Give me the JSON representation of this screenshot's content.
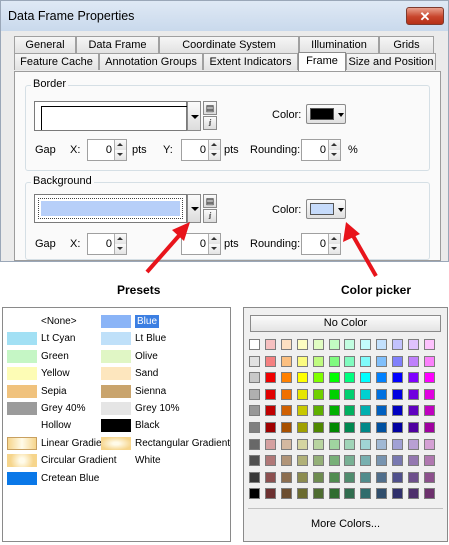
{
  "dialog": {
    "title": "Data Frame Properties",
    "close": "✕",
    "tabs_row1": [
      "General",
      "Data Frame",
      "Coordinate System",
      "Illumination",
      "Grids"
    ],
    "tabs_row2": [
      "Feature Cache",
      "Annotation Groups",
      "Extent Indicators",
      "Frame",
      "Size and Position"
    ],
    "active_tab": "Frame",
    "border": {
      "group_label": "Border",
      "color_label": "Color:",
      "color": "#000000",
      "gap_label": "Gap",
      "x_label": "X:",
      "x_value": "0",
      "x_unit": "pts",
      "y_label": "Y:",
      "y_value": "0",
      "y_unit": "pts",
      "rounding_label": "Rounding:",
      "rounding_value": "0",
      "rounding_unit": "%"
    },
    "background": {
      "group_label": "Background",
      "color_label": "Color:",
      "color": "#c6dbfb",
      "fill": "#b7cff9",
      "gap_label": "Gap",
      "x_label": "X:",
      "x_value": "0",
      "y_value": "0",
      "rounding_label": "Rounding:",
      "rounding_value": "0"
    }
  },
  "captions": {
    "presets": "Presets",
    "color_picker": "Color picker"
  },
  "presets": {
    "left": [
      {
        "label": "<None>",
        "color": ""
      },
      {
        "label": "Lt Cyan",
        "color": "#a2e0f4"
      },
      {
        "label": "Green",
        "color": "#c5f6c5"
      },
      {
        "label": "Yellow",
        "color": "#fdfcb5"
      },
      {
        "label": "Sepia",
        "color": "#f0c27d"
      },
      {
        "label": "Grey 40%",
        "color": "#9b9b9b"
      },
      {
        "label": "Hollow",
        "color": ""
      },
      {
        "label": "Linear Gradient",
        "color": "gradient-linear"
      },
      {
        "label": "Circular Gradient",
        "color": "gradient-circular"
      },
      {
        "label": "Cretean Blue",
        "color": "#0a78e8"
      }
    ],
    "right": [
      {
        "label": "Blue",
        "color": "#8ab4f7",
        "selected": true
      },
      {
        "label": "Lt Blue",
        "color": "#bfe0f9"
      },
      {
        "label": "Olive",
        "color": "#e0f6c5"
      },
      {
        "label": "Sand",
        "color": "#fde6be"
      },
      {
        "label": "Sienna",
        "color": "#c9a46d"
      },
      {
        "label": "Grey 10%",
        "color": "#e5e5e5"
      },
      {
        "label": "Black",
        "color": "#000000"
      },
      {
        "label": "Rectangular Gradient",
        "color": "gradient-rect"
      },
      {
        "label": "White",
        "color": ""
      }
    ]
  },
  "picker": {
    "no_color": "No Color",
    "more_colors": "More Colors...",
    "rows": [
      [
        "#ffffff",
        "#f6c0c0",
        "#fde0c2",
        "#fdfdc2",
        "#e0fdc2",
        "#c2fdc2",
        "#c2fde0",
        "#c2fdfd",
        "#c2e0fd",
        "#c2c2fd",
        "#e0c2fd",
        "#fdc2fd"
      ],
      [
        "#e1e1e1",
        "#f48080",
        "#fbbf80",
        "#fbfb80",
        "#bffb80",
        "#80fb80",
        "#80fbbf",
        "#80fbfb",
        "#80bffb",
        "#8080fb",
        "#bf80fb",
        "#fb80fb"
      ],
      [
        "#c8c8c8",
        "#f00000",
        "#ff8000",
        "#ffff00",
        "#80ff00",
        "#00ff00",
        "#00ff80",
        "#00ffff",
        "#0080ff",
        "#0000ff",
        "#8000ff",
        "#ff00ff"
      ],
      [
        "#b0b0b0",
        "#e00000",
        "#f07000",
        "#e6e600",
        "#70d000",
        "#00d000",
        "#00d070",
        "#00d0d0",
        "#0070e0",
        "#0000e0",
        "#7000e0",
        "#e000e0"
      ],
      [
        "#989898",
        "#c00000",
        "#d06000",
        "#c8c800",
        "#60b000",
        "#00b000",
        "#00b060",
        "#00b0b0",
        "#0060c0",
        "#0000c0",
        "#6000c0",
        "#c000c0"
      ],
      [
        "#808080",
        "#a00000",
        "#a85000",
        "#a0a000",
        "#508800",
        "#008800",
        "#008850",
        "#008888",
        "#0050a0",
        "#0000a0",
        "#5000a0",
        "#a000a0"
      ],
      [
        "#686868",
        "#d4a0a0",
        "#d4b8a0",
        "#d4d4a0",
        "#b8d4a0",
        "#a0d4a0",
        "#a0d4b8",
        "#a0d4d4",
        "#a0b8d4",
        "#a0a0d4",
        "#b8a0d4",
        "#d4a0d4"
      ],
      [
        "#505050",
        "#b07878",
        "#b09478",
        "#b0b078",
        "#94b078",
        "#78b078",
        "#78b094",
        "#78b0b0",
        "#7894b0",
        "#7878b0",
        "#9478b0",
        "#b078b0"
      ],
      [
        "#383838",
        "#8c5050",
        "#8c6e50",
        "#8c8c50",
        "#6e8c50",
        "#508c50",
        "#508c6e",
        "#508c8c",
        "#506e8c",
        "#50508c",
        "#6e508c",
        "#8c508c"
      ],
      [
        "#000000",
        "#6c3030",
        "#6c4e30",
        "#6c6c30",
        "#4e6c30",
        "#306c30",
        "#306c4e",
        "#306c6c",
        "#304e6c",
        "#30306c",
        "#4e306c",
        "#6c306c"
      ]
    ]
  }
}
